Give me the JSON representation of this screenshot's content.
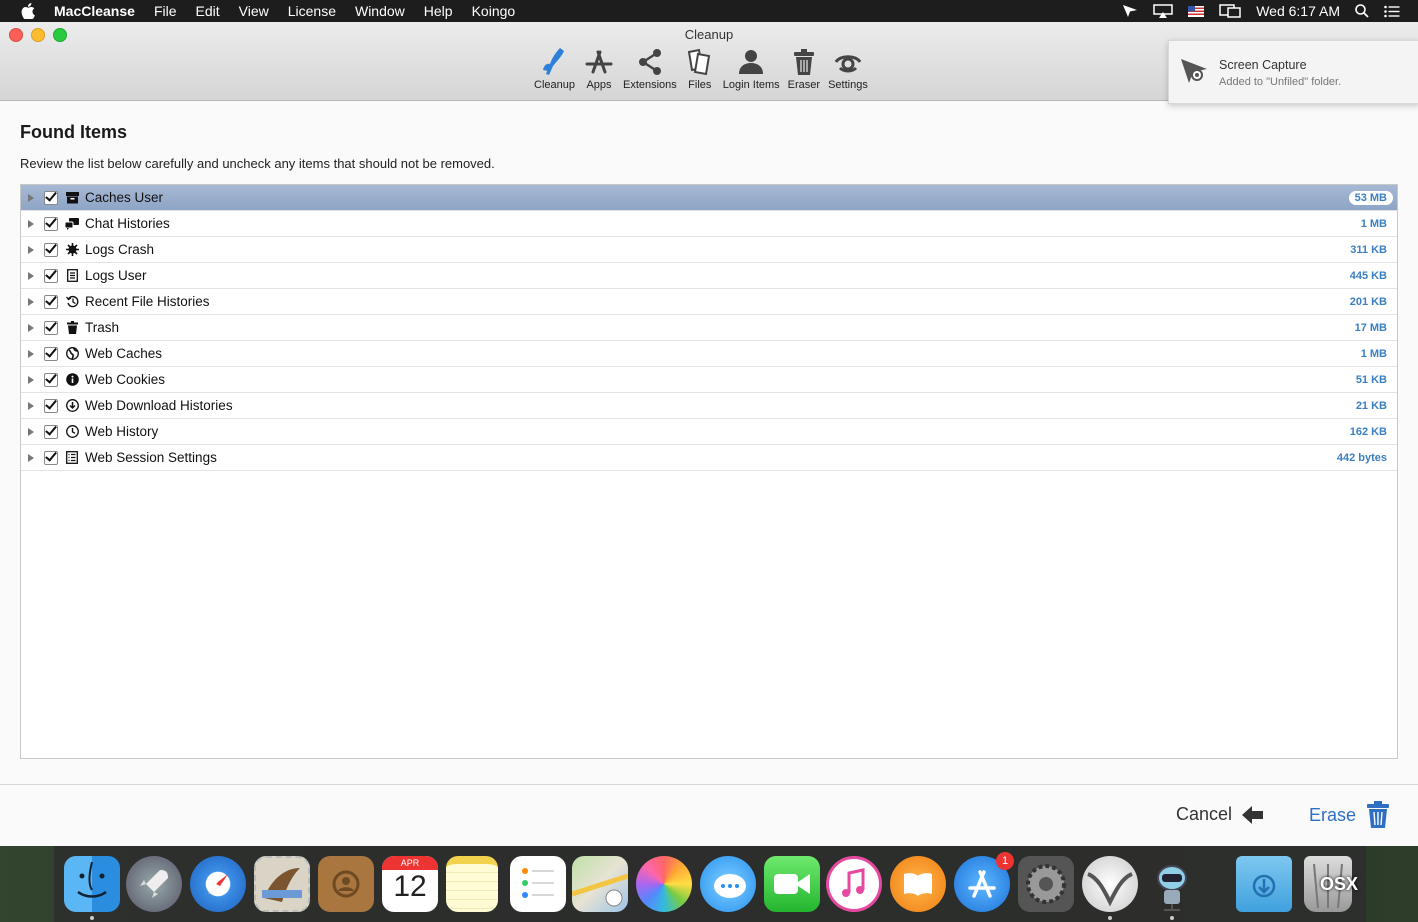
{
  "menubar": {
    "app_name": "MacCleanse",
    "items": [
      "File",
      "Edit",
      "View",
      "License",
      "Window",
      "Help",
      "Koingo"
    ],
    "clock": "Wed 6:17 AM"
  },
  "window": {
    "title": "Cleanup",
    "toolbar": [
      {
        "label": "Cleanup",
        "icon": "broom-icon"
      },
      {
        "label": "Apps",
        "icon": "apps-icon"
      },
      {
        "label": "Extensions",
        "icon": "share-icon"
      },
      {
        "label": "Files",
        "icon": "files-icon"
      },
      {
        "label": "Login Items",
        "icon": "user-icon"
      },
      {
        "label": "Eraser",
        "icon": "trash-icon"
      },
      {
        "label": "Settings",
        "icon": "settings-icon"
      }
    ]
  },
  "notification": {
    "title": "Screen Capture",
    "body": "Added to \"Unfiled\" folder."
  },
  "main": {
    "title": "Found Items",
    "description": "Review the list below carefully and uncheck any items that should not be removed.",
    "items": [
      {
        "label": "Caches User",
        "size": "53 MB",
        "icon": "archive-icon",
        "checked": true,
        "selected": true
      },
      {
        "label": "Chat Histories",
        "size": "1 MB",
        "icon": "chat-icon",
        "checked": true
      },
      {
        "label": "Logs Crash",
        "size": "311 KB",
        "icon": "bug-icon",
        "checked": true
      },
      {
        "label": "Logs User",
        "size": "445 KB",
        "icon": "document-icon",
        "checked": true
      },
      {
        "label": "Recent File Histories",
        "size": "201 KB",
        "icon": "history-icon",
        "checked": true
      },
      {
        "label": "Trash",
        "size": "17 MB",
        "icon": "trash-icon",
        "checked": true
      },
      {
        "label": "Web Caches",
        "size": "1 MB",
        "icon": "globe-icon",
        "checked": true
      },
      {
        "label": "Web Cookies",
        "size": "51 KB",
        "icon": "info-icon",
        "checked": true
      },
      {
        "label": "Web Download Histories",
        "size": "21 KB",
        "icon": "download-icon",
        "checked": true
      },
      {
        "label": "Web History",
        "size": "162 KB",
        "icon": "clock-icon",
        "checked": true
      },
      {
        "label": "Web Session Settings",
        "size": "442 bytes",
        "icon": "list-icon",
        "checked": true
      }
    ]
  },
  "footer": {
    "cancel_label": "Cancel",
    "erase_label": "Erase"
  },
  "dock": {
    "calendar_month": "APR",
    "calendar_day": "12",
    "appstore_badge": "1",
    "watermark": "OSX"
  },
  "colors": {
    "accent": "#2f6fc3",
    "size_text": "#3b7fc4",
    "selection": "#8ea5c6"
  }
}
